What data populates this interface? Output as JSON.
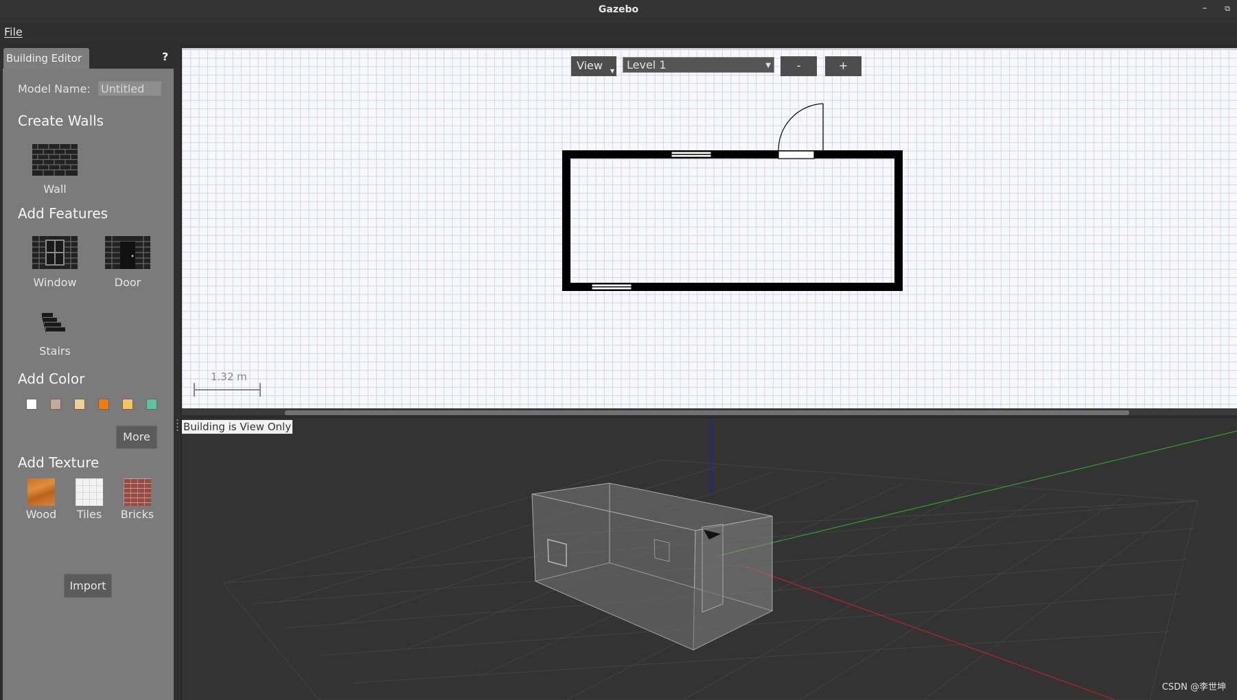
{
  "window": {
    "title": "Gazebo",
    "minimize_glyph": "–",
    "restore_glyph": "⧉"
  },
  "menu": {
    "file": "File"
  },
  "panel": {
    "tab_label": "Building Editor",
    "help": "?",
    "model_name_label": "Model Name:",
    "model_name_value": "Untitled",
    "create_walls": "Create Walls",
    "wall": "Wall",
    "add_features": "Add Features",
    "window": "Window",
    "door": "Door",
    "stairs": "Stairs",
    "add_color": "Add Color",
    "colors": [
      "#ffffff",
      "#c7a89c",
      "#f0cf98",
      "#f07c0c",
      "#f5c45c",
      "#5cc29c"
    ],
    "more": "More",
    "add_texture": "Add Texture",
    "wood": "Wood",
    "tiles": "Tiles",
    "bricks": "Bricks",
    "import": "Import"
  },
  "editor2d": {
    "view_button": "View",
    "level": "Level 1",
    "zoom_out": "-",
    "zoom_in": "+",
    "scale": "1.32 m"
  },
  "editor3d": {
    "status": "Building is View Only"
  },
  "watermark": "CSDN @李世坤"
}
